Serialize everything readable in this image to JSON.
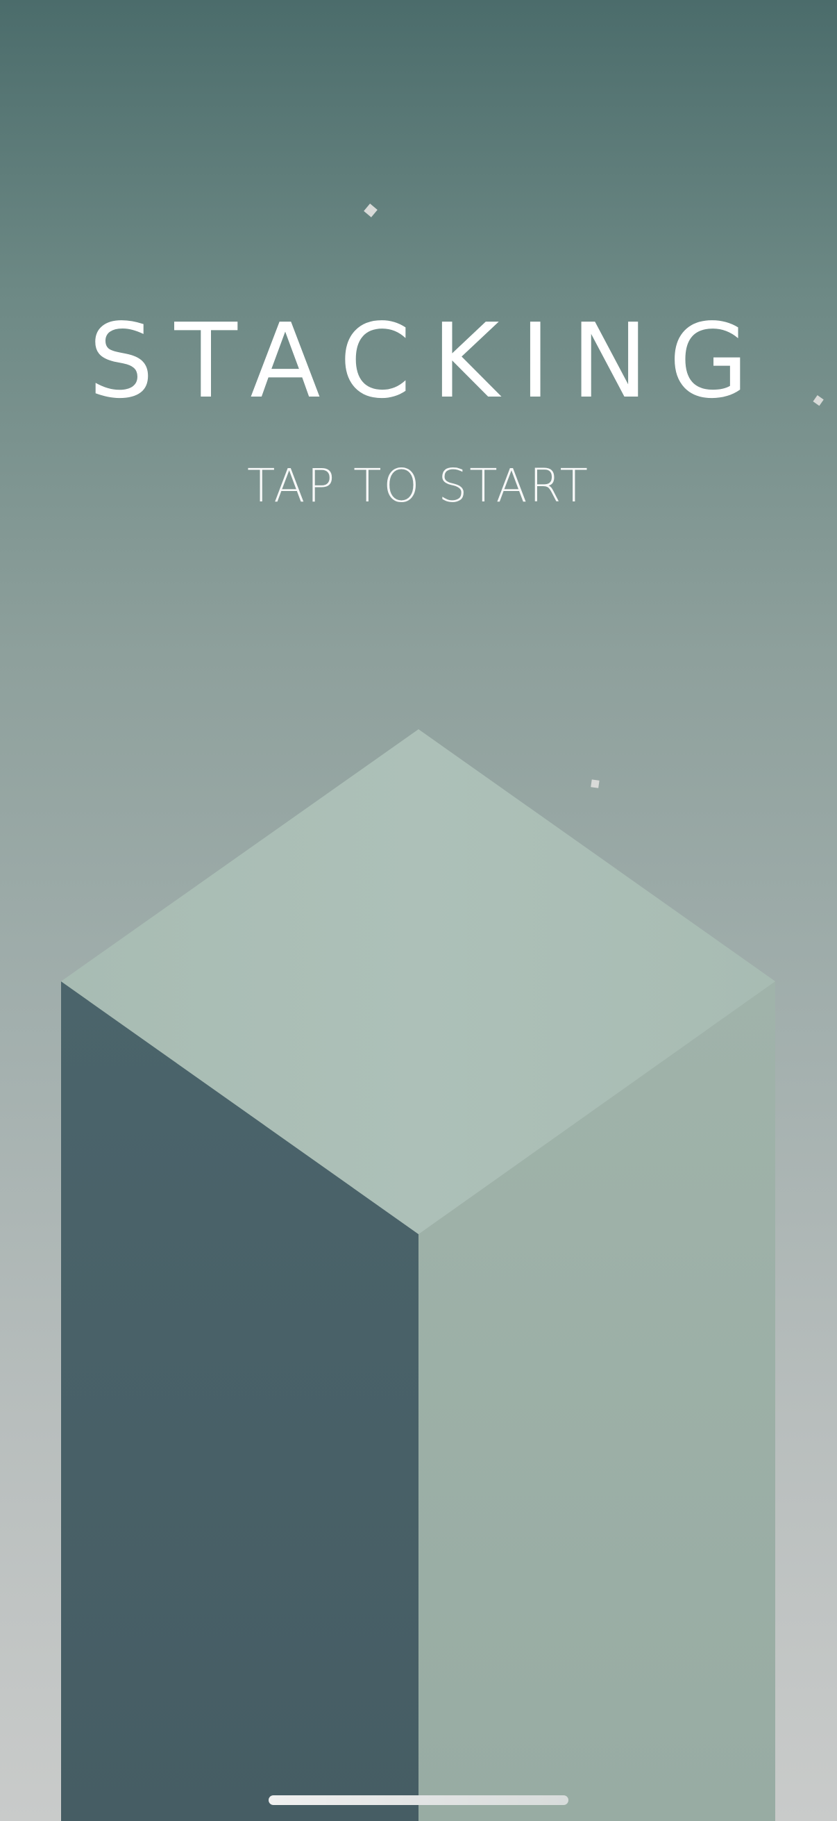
{
  "app": {
    "title": "STACKING",
    "prompt": "TAP TO START"
  },
  "colors": {
    "background_top": "#4b6c6b",
    "background_bottom": "#c9cbca",
    "block_top_face": "#abbfb6",
    "block_left_face": "#49636a",
    "block_right_face": "#9db1a8",
    "particle": "#d6d8d6",
    "text": "#ffffff"
  },
  "icons": {
    "block": "isometric-block-icon",
    "particles": "square-particle-icon"
  }
}
